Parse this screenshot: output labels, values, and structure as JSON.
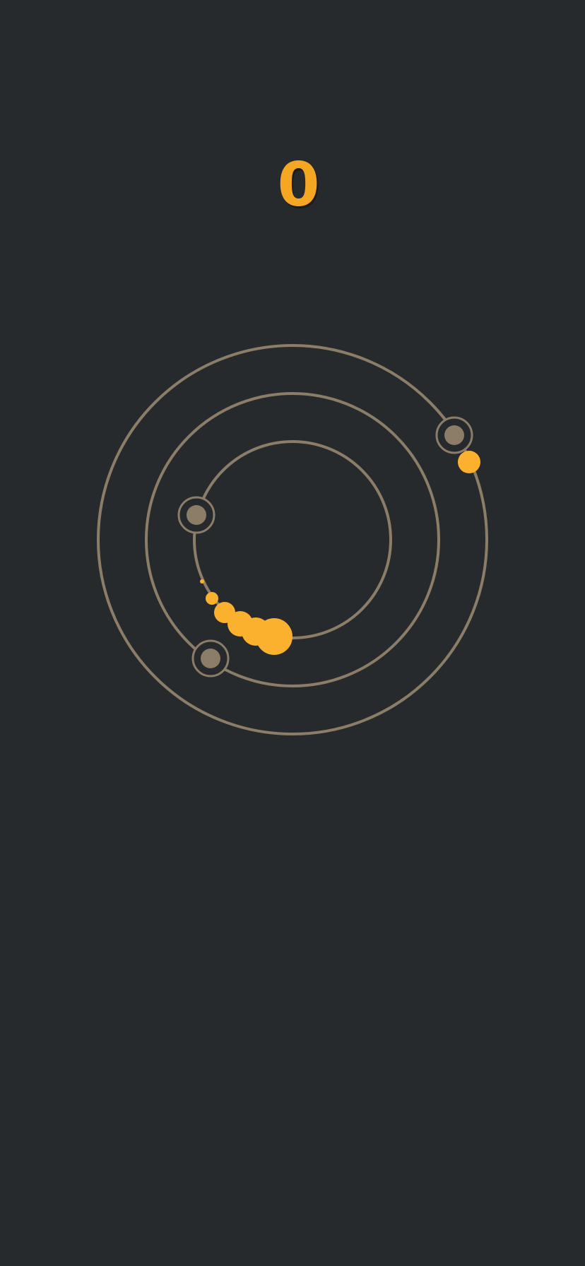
{
  "score": "0",
  "colors": {
    "background": "#272a2d",
    "ring": "#8b7d68",
    "planet": "#8b7d68",
    "player": "#fbb12d",
    "score": "#f5a623"
  },
  "rings": [
    {
      "name": "inner-orbit"
    },
    {
      "name": "middle-orbit"
    },
    {
      "name": "outer-orbit"
    }
  ],
  "planets": [
    {
      "name": "planet-outer-ring"
    },
    {
      "name": "planet-inner-ring"
    },
    {
      "name": "planet-middle-ring"
    }
  ],
  "collectible": {
    "name": "orange-dot-icon"
  },
  "player": {
    "name": "player-comet-icon"
  }
}
